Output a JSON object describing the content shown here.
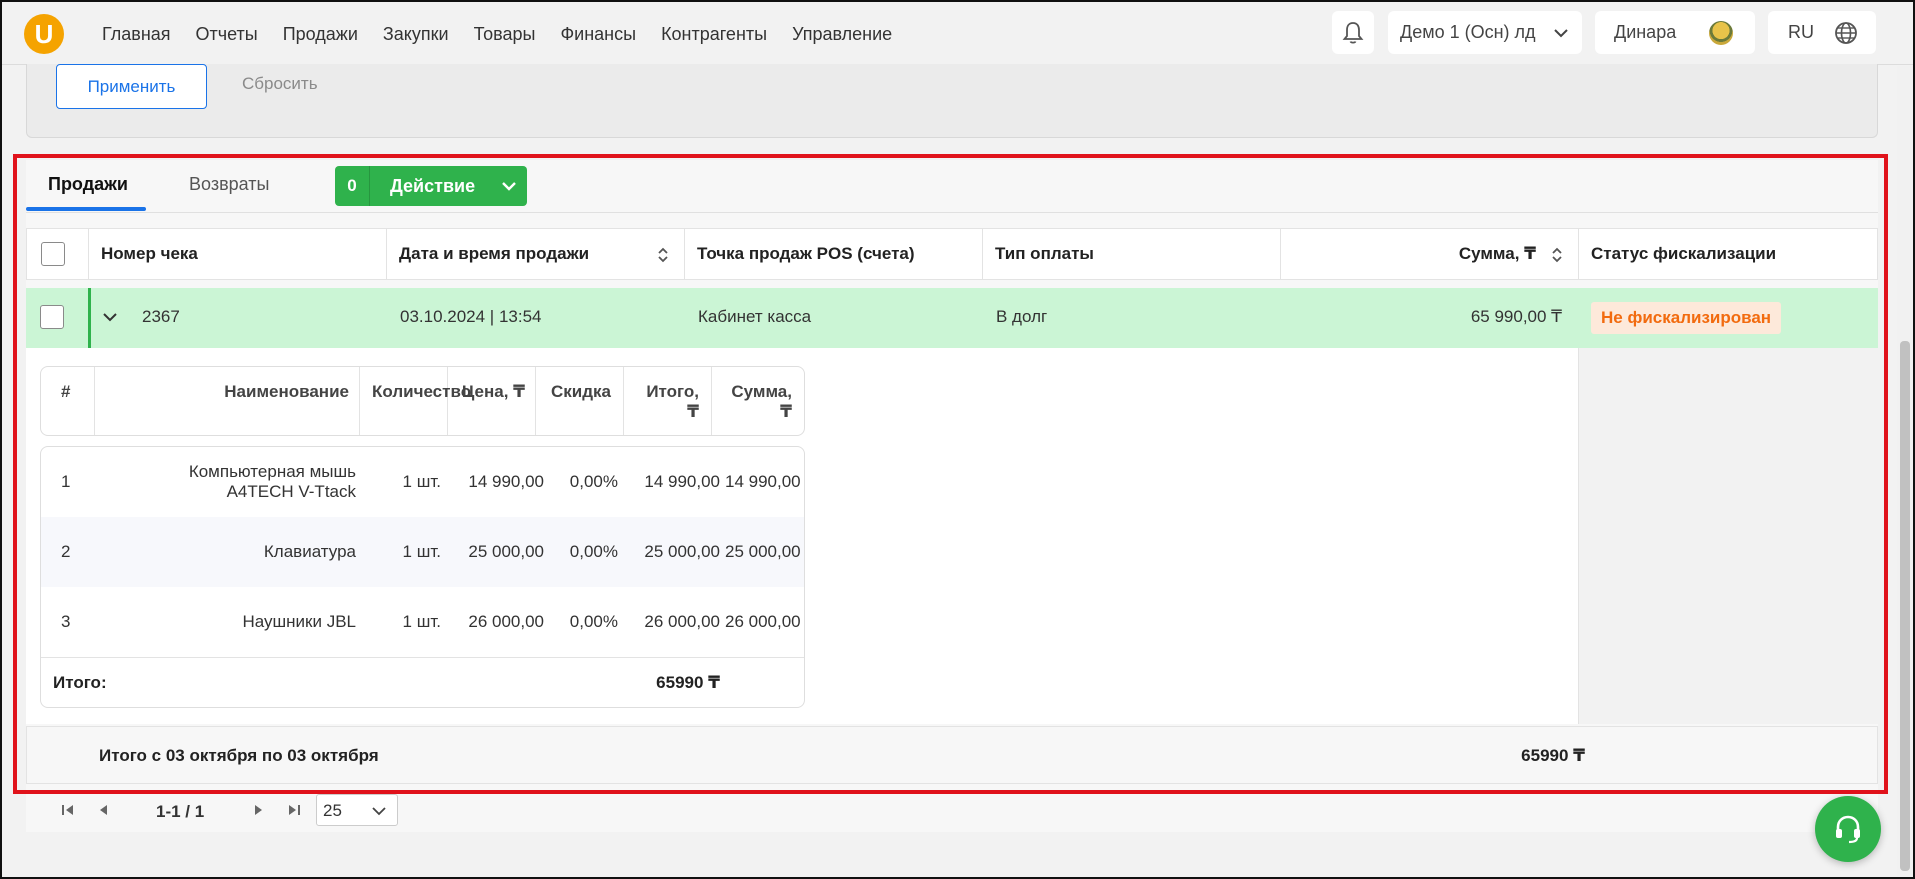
{
  "logo": {
    "letter": "U"
  },
  "nav": [
    "Главная",
    "Отчеты",
    "Продажи",
    "Закупки",
    "Товары",
    "Финансы",
    "Контрагенты",
    "Управление"
  ],
  "header": {
    "org": "Демо 1 (Осн) лд",
    "user": "Динара",
    "lang": "RU"
  },
  "filters": {
    "apply_label": "Применить",
    "reset_label": "Сбросить"
  },
  "tabs": {
    "sales": "Продажи",
    "returns": "Возвраты"
  },
  "action": {
    "count": "0",
    "label": "Действие"
  },
  "table": {
    "headers": {
      "receipt_no": "Номер чека",
      "datetime": "Дата и время продажи",
      "pos": "Точка продаж POS (счета)",
      "payment_type": "Тип оплаты",
      "sum": "Сумма, ₸",
      "fiscal_status": "Статус фискализации"
    },
    "row": {
      "receipt_no": "2367",
      "datetime": "03.10.2024 | 13:54",
      "pos": "Кабинет касса",
      "payment_type": "В долг",
      "sum": "65 990,00 ₸",
      "fiscal_status": "Не фискализирован"
    }
  },
  "items": {
    "headers": {
      "num": "#",
      "name": "Наименование",
      "qty": "Количество",
      "price": "Цена, ₸",
      "discount": "Скидка",
      "total_line1": "Итого,",
      "total_line2": "₸",
      "sum_line1": "Сумма,",
      "sum_line2": "₸"
    },
    "rows": [
      {
        "num": "1",
        "name_line1": "Компьютерная мышь",
        "name_line2": "A4TECH V-Ttack",
        "qty": "1 шт.",
        "price": "14 990,00",
        "discount": "0,00%",
        "total": "14 990,00",
        "sum": "14 990,00"
      },
      {
        "num": "2",
        "name": "Клавиатура",
        "qty": "1 шт.",
        "price": "25 000,00",
        "discount": "0,00%",
        "total": "25 000,00",
        "sum": "25 000,00"
      },
      {
        "num": "3",
        "name": "Наушники JBL",
        "qty": "1 шт.",
        "price": "26 000,00",
        "discount": "0,00%",
        "total": "26 000,00",
        "sum": "26 000,00"
      }
    ],
    "total_label": "Итого:",
    "total_value": "65990 ₸"
  },
  "summary": {
    "label": "Итого с 03 октября по 03 октября",
    "value": "65990 ₸"
  },
  "pager": {
    "range": "1-1 / 1",
    "page_size": "25"
  },
  "colors": {
    "accent": "#1a73e8",
    "green": "#2fb24c",
    "row_highlight": "#cbf5d5",
    "badge_text": "#f26b0f",
    "frame": "#e0121b"
  }
}
